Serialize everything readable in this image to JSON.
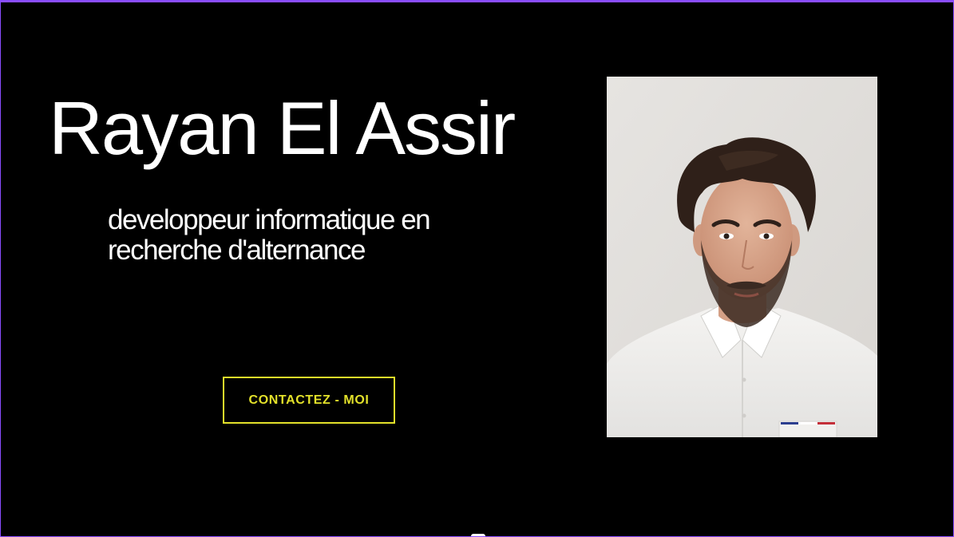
{
  "hero": {
    "name": "Rayan El Assir",
    "tagline": "developpeur informatique en recherche d'alternance",
    "contact_button": "CONTACTEZ - MOI"
  },
  "profile_photo": {
    "alt": "Rayan El Assir"
  },
  "colors": {
    "background": "#000000",
    "text": "#ffffff",
    "accent": "#e3e12a",
    "frame_border": "#8a4dff"
  }
}
